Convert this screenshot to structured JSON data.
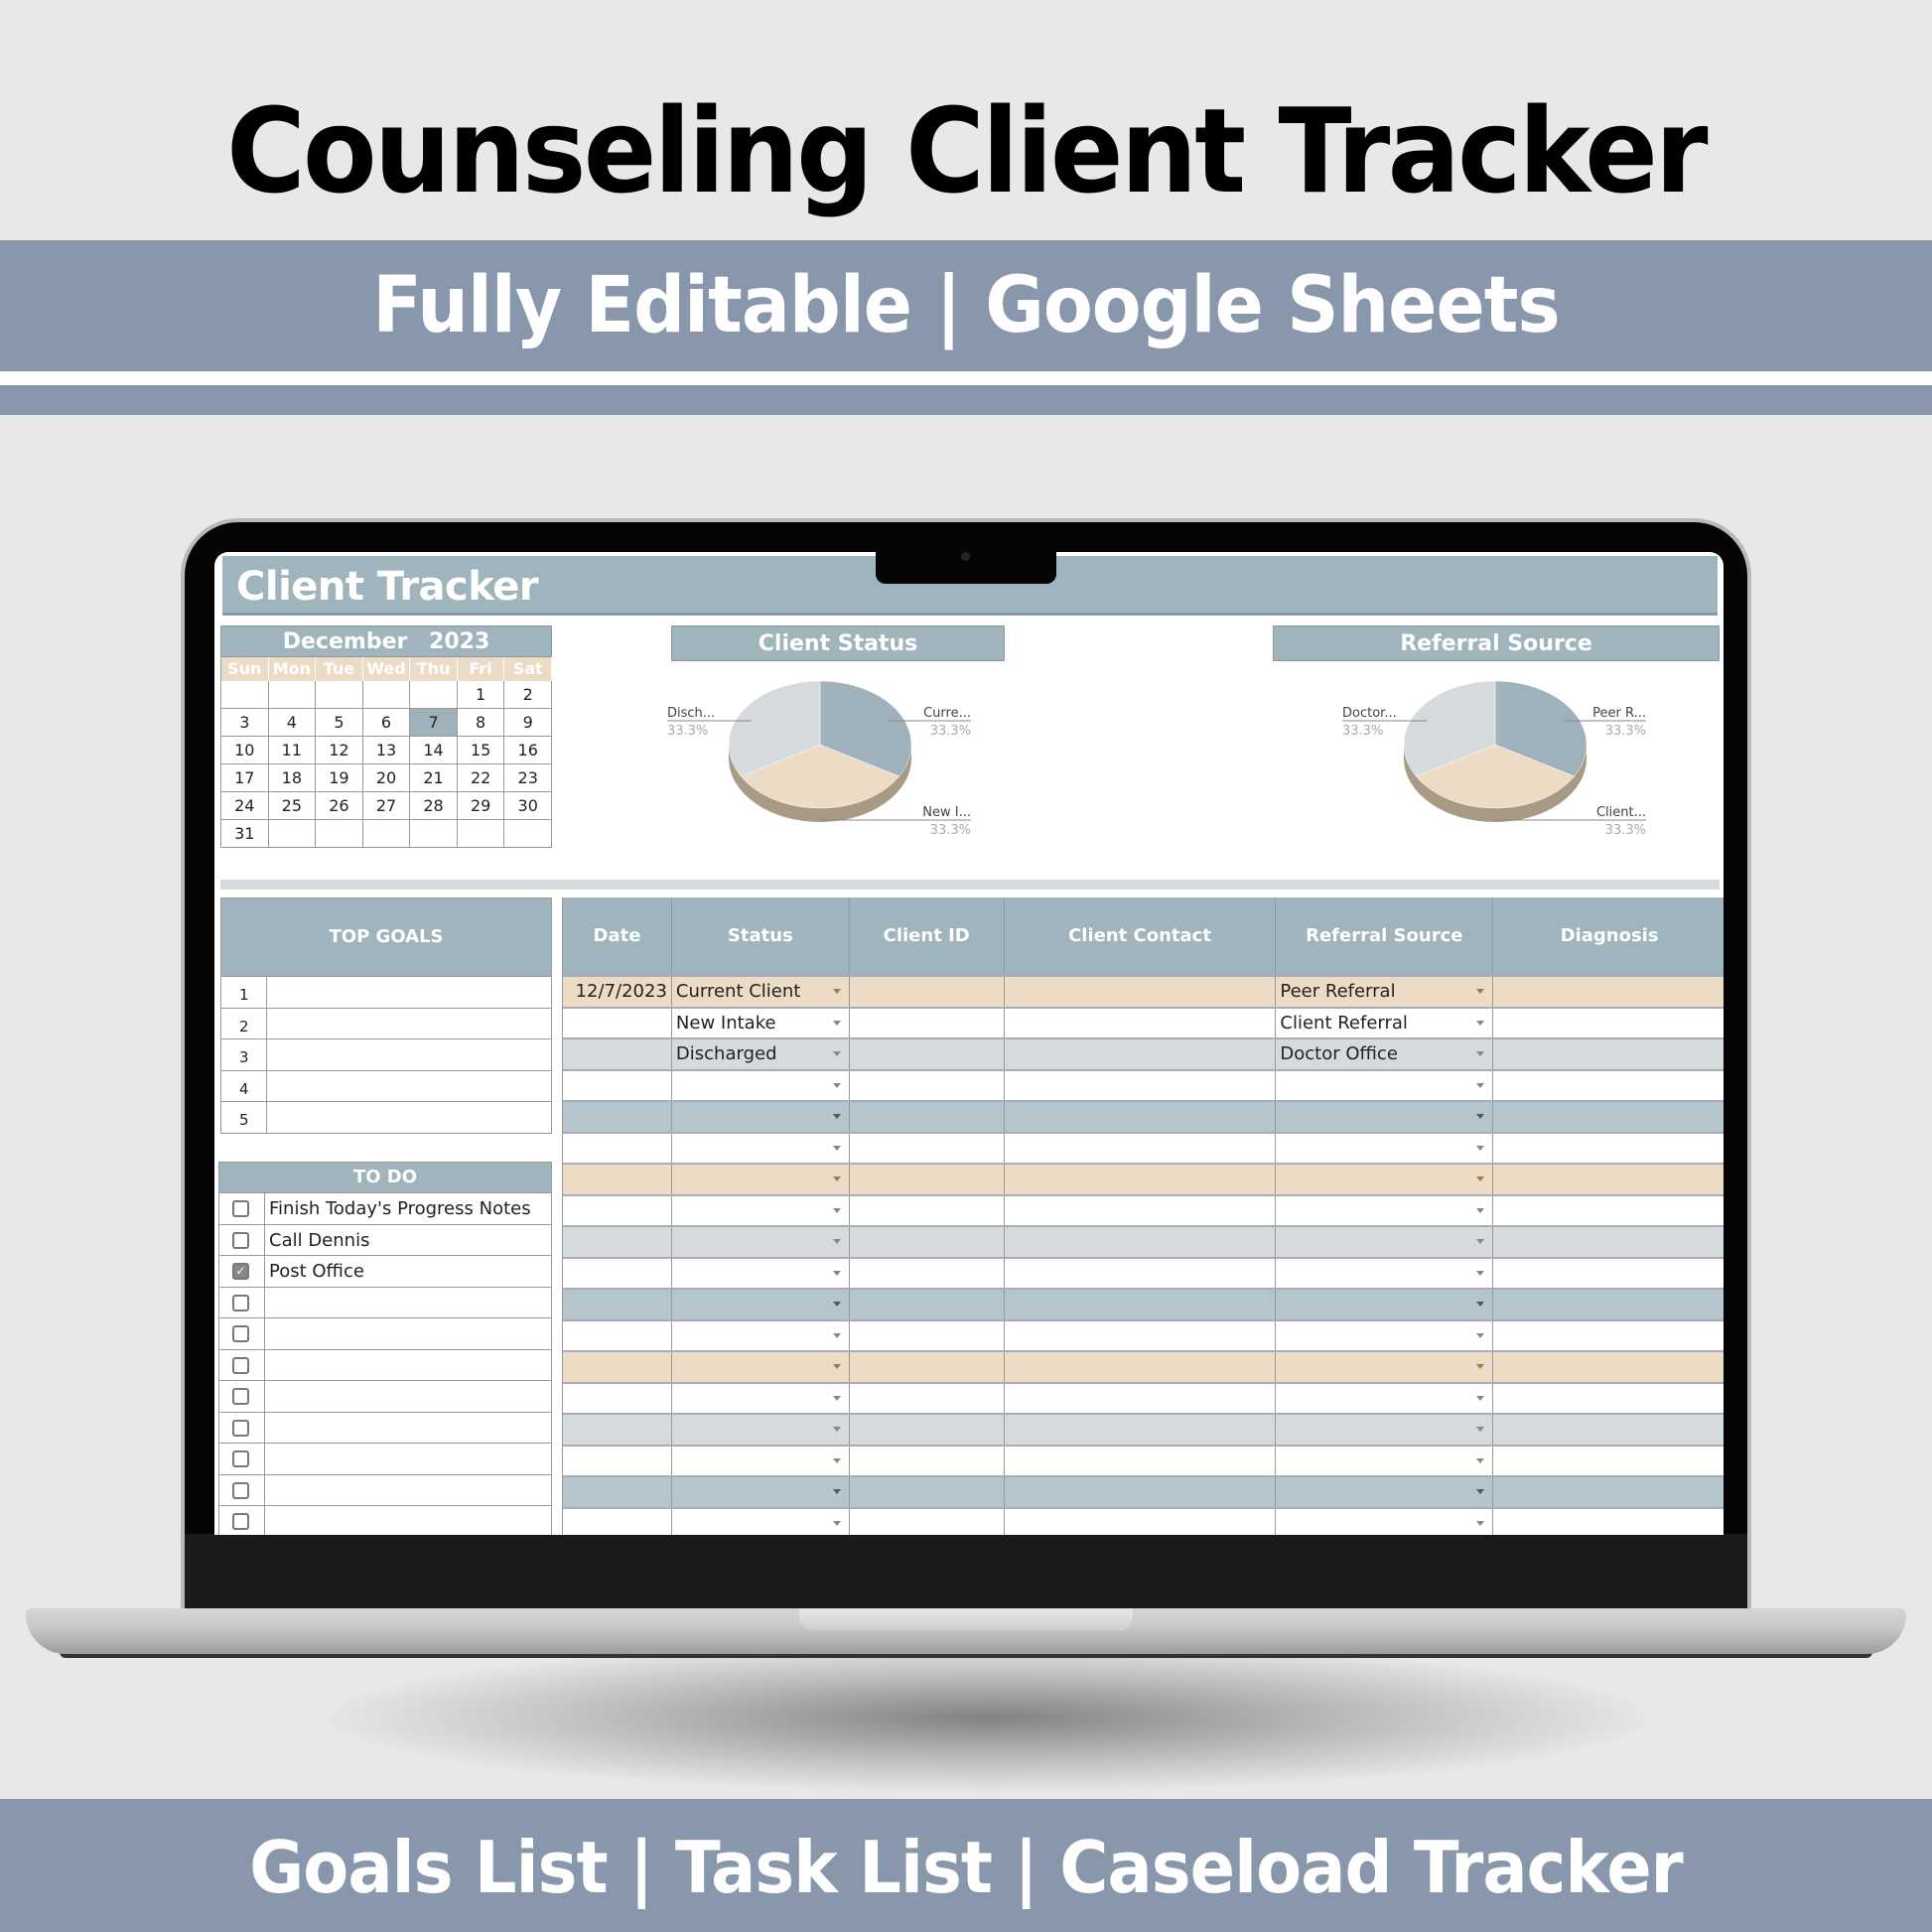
{
  "banner": {
    "title": "Counseling Client Tracker",
    "subtitle": "Fully Editable | Google Sheets",
    "footer": "Goals List | Task List | Caseload Tracker"
  },
  "colors": {
    "band_blue": "#8897ac",
    "header_blue": "#a0b4be",
    "tan": "#ecdcc6",
    "grey": "#d5dadd",
    "row_blue": "#b4c5cd"
  },
  "app": {
    "title": "Client Tracker"
  },
  "calendar": {
    "month": "December",
    "year": "2023",
    "weekdays": [
      "Sun",
      "Mon",
      "Tue",
      "Wed",
      "Thu",
      "Fri",
      "Sat"
    ],
    "weeks": [
      [
        "",
        "",
        "",
        "",
        "",
        "1",
        "2"
      ],
      [
        "3",
        "4",
        "5",
        "6",
        "7",
        "8",
        "9"
      ],
      [
        "10",
        "11",
        "12",
        "13",
        "14",
        "15",
        "16"
      ],
      [
        "17",
        "18",
        "19",
        "20",
        "21",
        "22",
        "23"
      ],
      [
        "24",
        "25",
        "26",
        "27",
        "28",
        "29",
        "30"
      ],
      [
        "31",
        "",
        "",
        "",
        "",
        "",
        ""
      ]
    ],
    "today": "7"
  },
  "chart_data": [
    {
      "type": "pie",
      "title": "Client Status",
      "categories": [
        "Current Client",
        "New Intake",
        "Discharged"
      ],
      "labels": [
        "Curre...",
        "New I...",
        "Disch..."
      ],
      "values": [
        33.3,
        33.3,
        33.3
      ],
      "value_labels": [
        "33.3%",
        "33.3%",
        "33.3%"
      ],
      "colors": [
        "#9fb2bc",
        "#ecdcc6",
        "#d5dadd"
      ],
      "style": "3d"
    },
    {
      "type": "pie",
      "title": "Referral Source",
      "categories": [
        "Peer Referral",
        "Client Referral",
        "Doctor Office"
      ],
      "labels": [
        "Peer R...",
        "Client...",
        "Doctor..."
      ],
      "values": [
        33.3,
        33.3,
        33.3
      ],
      "value_labels": [
        "33.3%",
        "33.3%",
        "33.3%"
      ],
      "colors": [
        "#9fb2bc",
        "#ecdcc6",
        "#d5dadd"
      ],
      "style": "3d"
    }
  ],
  "goals": {
    "heading": "TOP GOALS",
    "items": [
      {
        "num": "1",
        "text": ""
      },
      {
        "num": "2",
        "text": ""
      },
      {
        "num": "3",
        "text": ""
      },
      {
        "num": "4",
        "text": ""
      },
      {
        "num": "5",
        "text": ""
      }
    ]
  },
  "todo": {
    "heading": "TO DO",
    "items": [
      {
        "text": "Finish Today's Progress Notes",
        "checked": false
      },
      {
        "text": "Call Dennis",
        "checked": false
      },
      {
        "text": "Post Office",
        "checked": true
      },
      {
        "text": "",
        "checked": false
      },
      {
        "text": "",
        "checked": false
      },
      {
        "text": "",
        "checked": false
      },
      {
        "text": "",
        "checked": false
      },
      {
        "text": "",
        "checked": false
      },
      {
        "text": "",
        "checked": false
      },
      {
        "text": "",
        "checked": false
      },
      {
        "text": "",
        "checked": false
      }
    ]
  },
  "table": {
    "columns": [
      "Date",
      "Status",
      "Client ID",
      "Client Contact",
      "Referral Source",
      "Diagnosis"
    ],
    "rows": [
      {
        "date": "12/7/2023",
        "status": "Current Client",
        "client_id": "",
        "contact": "",
        "referral": "Peer Referral",
        "diagnosis": "",
        "band": "tan"
      },
      {
        "date": "",
        "status": "New Intake",
        "client_id": "",
        "contact": "",
        "referral": "Client Referral",
        "diagnosis": "",
        "band": "white"
      },
      {
        "date": "",
        "status": "Discharged",
        "client_id": "",
        "contact": "",
        "referral": "Doctor Office",
        "diagnosis": "",
        "band": "grey"
      },
      {
        "date": "",
        "status": "",
        "client_id": "",
        "contact": "",
        "referral": "",
        "diagnosis": "",
        "band": "white"
      },
      {
        "date": "",
        "status": "",
        "client_id": "",
        "contact": "",
        "referral": "",
        "diagnosis": "",
        "band": "blue"
      },
      {
        "date": "",
        "status": "",
        "client_id": "",
        "contact": "",
        "referral": "",
        "diagnosis": "",
        "band": "white"
      },
      {
        "date": "",
        "status": "",
        "client_id": "",
        "contact": "",
        "referral": "",
        "diagnosis": "",
        "band": "tan"
      },
      {
        "date": "",
        "status": "",
        "client_id": "",
        "contact": "",
        "referral": "",
        "diagnosis": "",
        "band": "white"
      },
      {
        "date": "",
        "status": "",
        "client_id": "",
        "contact": "",
        "referral": "",
        "diagnosis": "",
        "band": "grey"
      },
      {
        "date": "",
        "status": "",
        "client_id": "",
        "contact": "",
        "referral": "",
        "diagnosis": "",
        "band": "white"
      },
      {
        "date": "",
        "status": "",
        "client_id": "",
        "contact": "",
        "referral": "",
        "diagnosis": "",
        "band": "blue"
      },
      {
        "date": "",
        "status": "",
        "client_id": "",
        "contact": "",
        "referral": "",
        "diagnosis": "",
        "band": "white"
      },
      {
        "date": "",
        "status": "",
        "client_id": "",
        "contact": "",
        "referral": "",
        "diagnosis": "",
        "band": "tan"
      },
      {
        "date": "",
        "status": "",
        "client_id": "",
        "contact": "",
        "referral": "",
        "diagnosis": "",
        "band": "white"
      },
      {
        "date": "",
        "status": "",
        "client_id": "",
        "contact": "",
        "referral": "",
        "diagnosis": "",
        "band": "grey"
      },
      {
        "date": "",
        "status": "",
        "client_id": "",
        "contact": "",
        "referral": "",
        "diagnosis": "",
        "band": "white"
      },
      {
        "date": "",
        "status": "",
        "client_id": "",
        "contact": "",
        "referral": "",
        "diagnosis": "",
        "band": "blue"
      },
      {
        "date": "",
        "status": "",
        "client_id": "",
        "contact": "",
        "referral": "",
        "diagnosis": "",
        "band": "white"
      }
    ]
  }
}
